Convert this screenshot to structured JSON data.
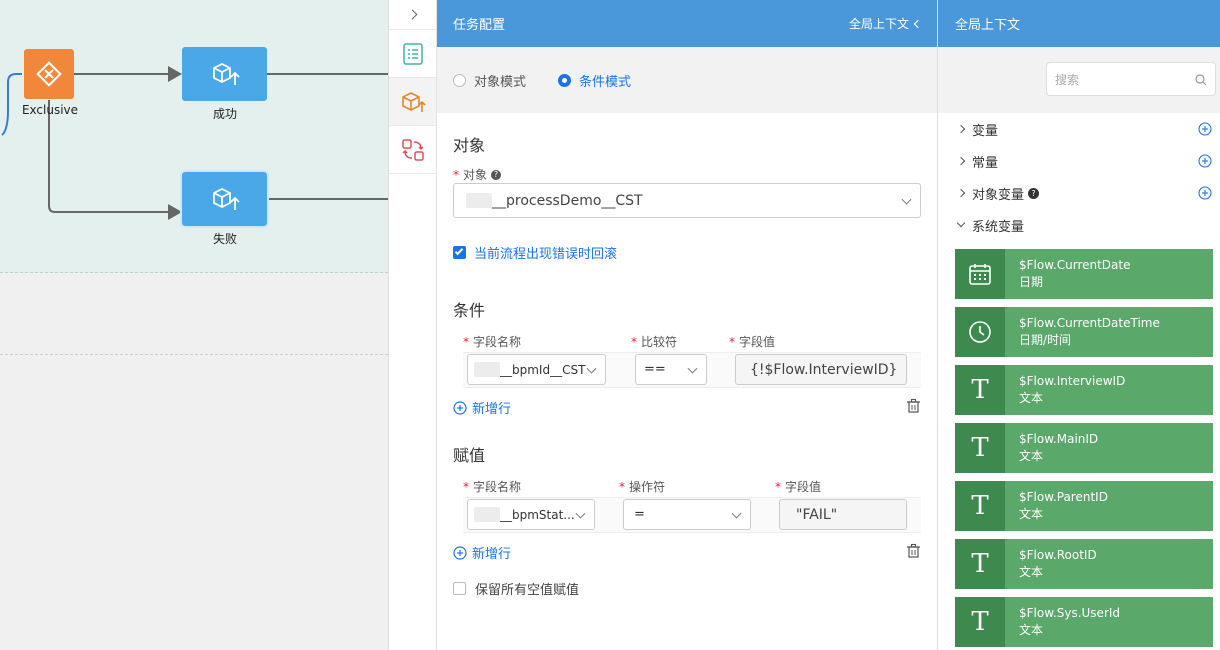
{
  "flow": {
    "exclusive_label": "Exclusive",
    "success_label": "成功",
    "fail_label": "失败"
  },
  "config": {
    "title": "任务配置",
    "context_link": "全局上下文",
    "mode_object": "对象模式",
    "mode_condition": "条件模式",
    "selected_mode": "条件模式",
    "section_object": "对象",
    "object_label": "对象",
    "object_value": "__processDemo__CST",
    "rollback_label": "当前流程出现错误时回滚",
    "rollback_checked": true,
    "section_condition": "条件",
    "cond_field_label": "字段名称",
    "cond_op_label": "比较符",
    "cond_value_label": "字段值",
    "cond_field_value": "__bpmId__CST",
    "cond_op_value": "==",
    "cond_value": "{!$Flow.InterviewID}",
    "add_row_label": "新增行",
    "section_assign": "赋值",
    "assign_field_label": "字段名称",
    "assign_op_label": "操作符",
    "assign_value_label": "字段值",
    "assign_field_value": "__bpmStat...",
    "assign_op_value": "=",
    "assign_value": "\"FAIL\"",
    "add_row_label2": "新增行",
    "keep_null_label": "保留所有空值赋值",
    "keep_null_checked": false
  },
  "context": {
    "title": "全局上下文",
    "search_placeholder": "搜索",
    "categories": [
      {
        "label": "变量",
        "expanded": false
      },
      {
        "label": "常量",
        "expanded": false
      },
      {
        "label": "对象变量",
        "expanded": false
      },
      {
        "label": "系统变量",
        "expanded": true
      }
    ],
    "variables": [
      {
        "name": "$Flow.CurrentDate",
        "type": "日期",
        "icon": "calendar-icon"
      },
      {
        "name": "$Flow.CurrentDateTime",
        "type": "日期/时间",
        "icon": "clock-icon"
      },
      {
        "name": "$Flow.InterviewID",
        "type": "文本",
        "icon": "text-icon"
      },
      {
        "name": "$Flow.MainID",
        "type": "文本",
        "icon": "text-icon"
      },
      {
        "name": "$Flow.ParentID",
        "type": "文本",
        "icon": "text-icon"
      },
      {
        "name": "$Flow.RootID",
        "type": "文本",
        "icon": "text-icon"
      },
      {
        "name": "$Flow.Sys.UserId",
        "type": "文本",
        "icon": "text-icon"
      }
    ]
  },
  "colors": {
    "header_blue": "#4a98d9",
    "accent_blue": "#1a73e8",
    "var_green": "#5aa86a",
    "var_icon_green": "#3e8a4e",
    "exclusive_orange": "#f0873a",
    "task_blue": "#4aa8e8"
  }
}
